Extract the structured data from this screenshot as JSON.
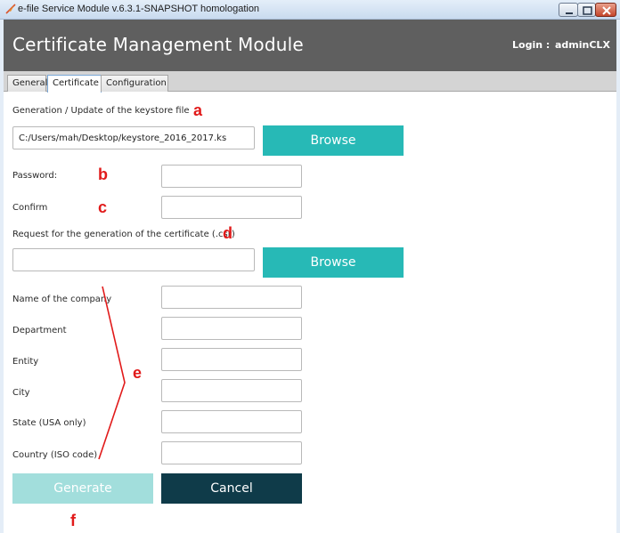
{
  "window": {
    "title": "e-file Service Module v.6.3.1-SNAPSHOT homologation",
    "app_icon": "feather-icon",
    "controls": [
      "minimize-icon",
      "maximize-icon",
      "close-icon"
    ]
  },
  "header": {
    "title": "Certificate Management Module",
    "login_label": "Login :",
    "login_user": "adminCLX",
    "background": "#5f5f5f"
  },
  "tabs": [
    {
      "label": "General",
      "active": false
    },
    {
      "label": "Certificate",
      "active": true
    },
    {
      "label": "Configuration",
      "active": false
    }
  ],
  "form": {
    "keystore_label": "Generation / Update of the keystore file",
    "keystore_path": "C:/Users/mah/Desktop/keystore_2016_2017.ks",
    "browse_label": "Browse",
    "password_label": "Password:",
    "password_value": "",
    "confirm_label": "Confirm",
    "confirm_value": "",
    "csr_label": "Request for the generation of the certificate (.csr)",
    "csr_value": "",
    "csr_browse_label": "Browse",
    "company_label": "Name of the company",
    "department_label": "Department",
    "entity_label": "Entity",
    "city_label": "City",
    "state_label": "State (USA only)",
    "country_label": "Country (ISO code)",
    "company_value": "",
    "department_value": "",
    "entity_value": "",
    "city_value": "",
    "state_value": "",
    "country_value": "",
    "generate_label": "Generate",
    "cancel_label": "Cancel"
  },
  "annotations": {
    "a": "a",
    "b": "b",
    "c": "c",
    "d": "d",
    "e": "e",
    "f": "f",
    "color": "#e11a1a"
  },
  "colors": {
    "browse": "#27b9b6",
    "generate_disabled": "#a2dedc",
    "cancel": "#0f3b49"
  }
}
